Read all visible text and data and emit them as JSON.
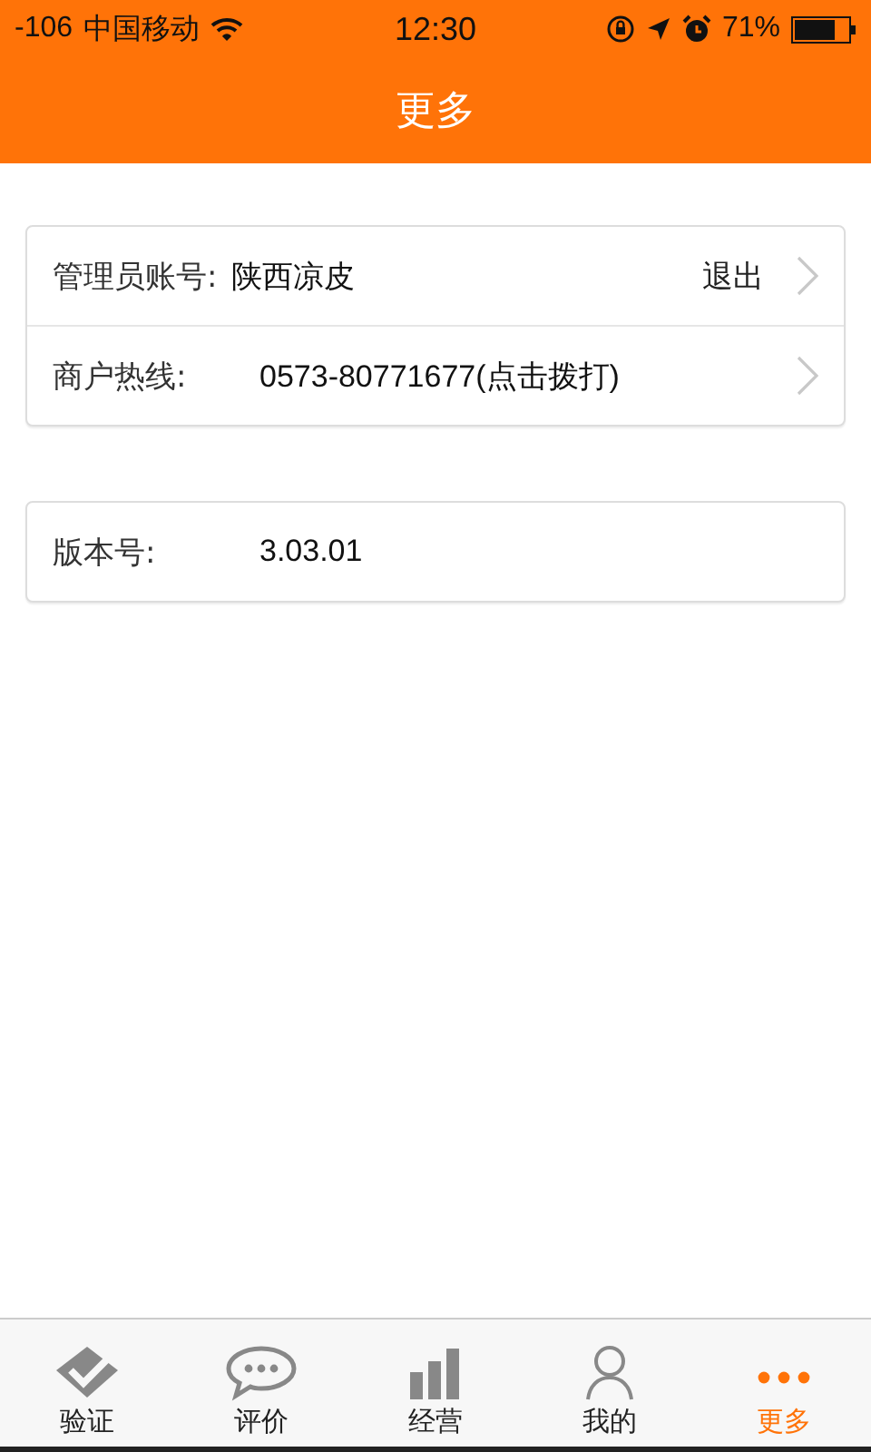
{
  "status_bar": {
    "signal": "-106",
    "carrier": "中国移动",
    "time": "12:30",
    "battery": "71%"
  },
  "header": {
    "title": "更多"
  },
  "groups": [
    {
      "rows": [
        {
          "label": "管理员账号:",
          "value": "陕西凉皮",
          "action": "退出",
          "arrow": true
        },
        {
          "label": "商户热线:",
          "value": "0573-80771677(点击拨打)",
          "arrow": true
        }
      ]
    },
    {
      "rows": [
        {
          "label": "版本号:",
          "value": "3.03.01",
          "arrow": false
        }
      ]
    }
  ],
  "tabs": [
    {
      "label": "验证",
      "kind": "check",
      "selected": false
    },
    {
      "label": "评价",
      "kind": "chat",
      "selected": false
    },
    {
      "label": "经营",
      "kind": "bars",
      "selected": false
    },
    {
      "label": "我的",
      "kind": "person",
      "selected": false
    },
    {
      "label": "更多",
      "kind": "dots",
      "selected": true
    }
  ]
}
